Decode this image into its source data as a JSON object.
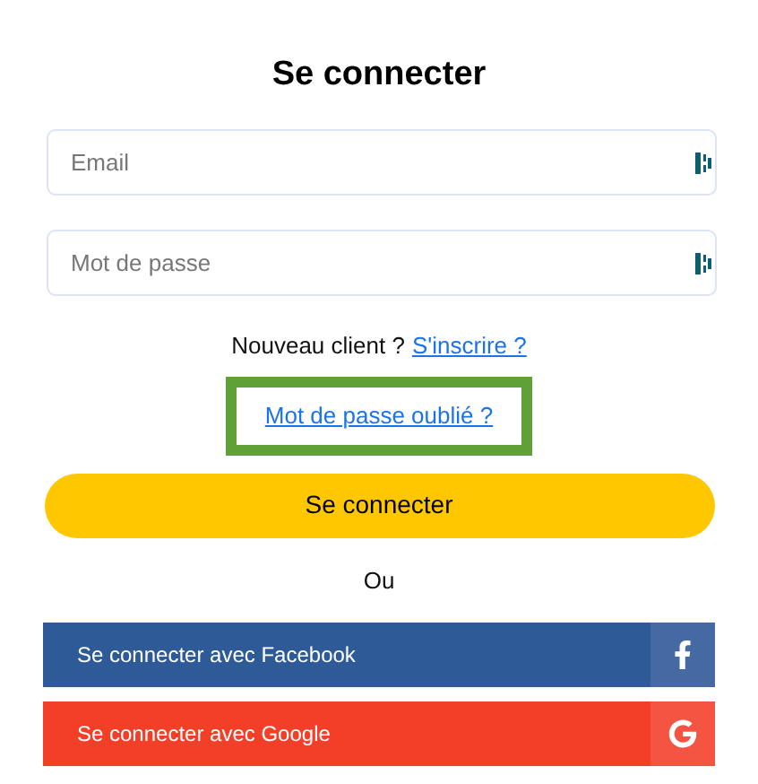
{
  "title": "Se connecter",
  "fields": [
    {
      "placeholder": "Email"
    },
    {
      "placeholder": "Mot de passe"
    }
  ],
  "signup": {
    "text": "Nouveau client ?",
    "link": "S'inscrire ?"
  },
  "forgot_link": {
    "label": "Mot de passe oublié ?",
    "highlighted": true
  },
  "submit_button": "Se connecter",
  "separator": "Ou",
  "social_buttons": [
    {
      "kind": "facebook",
      "label": "Se connecter avec Facebook"
    },
    {
      "kind": "google",
      "label": "Se connecter avec Google"
    }
  ]
}
